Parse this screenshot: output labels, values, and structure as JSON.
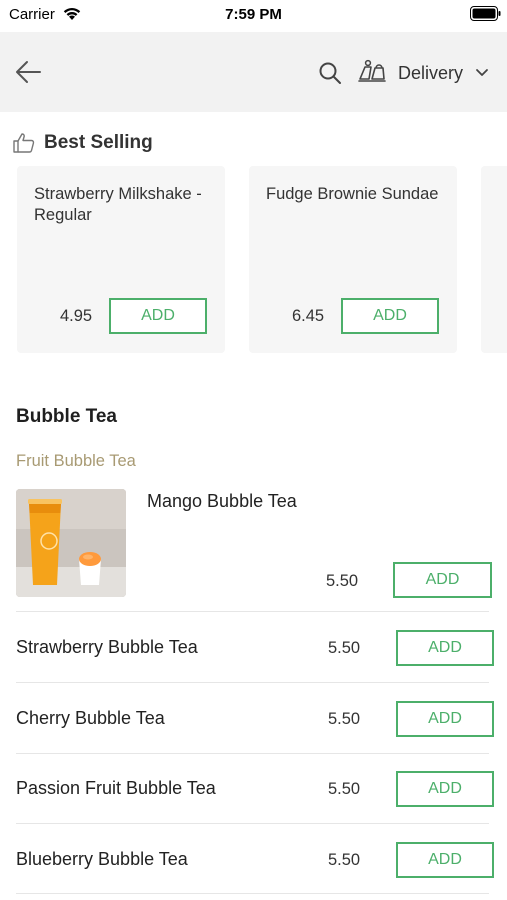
{
  "status_bar": {
    "carrier": "Carrier",
    "time": "7:59 PM"
  },
  "nav": {
    "delivery_label": "Delivery"
  },
  "best_selling": {
    "title": "Best Selling",
    "items": [
      {
        "name": "Strawberry Milkshake - Regular",
        "price": "4.95",
        "add_label": "ADD"
      },
      {
        "name": "Fudge Brownie Sundae",
        "price": "6.45",
        "add_label": "ADD"
      }
    ]
  },
  "category": {
    "title": "Bubble Tea",
    "subcategory": "Fruit Bubble Tea",
    "featured": {
      "name": "Mango Bubble Tea",
      "price": "5.50",
      "add_label": "ADD"
    },
    "items": [
      {
        "name": "Strawberry Bubble Tea",
        "price": "5.50",
        "add_label": "ADD"
      },
      {
        "name": "Cherry Bubble Tea",
        "price": "5.50",
        "add_label": "ADD"
      },
      {
        "name": "Passion Fruit Bubble Tea",
        "price": "5.50",
        "add_label": "ADD"
      },
      {
        "name": "Blueberry Bubble Tea",
        "price": "5.50",
        "add_label": "ADD"
      }
    ]
  },
  "colors": {
    "accent": "#4caf6a",
    "subcategory": "#a89a73",
    "nav_background": "#f2f2f2",
    "card_background": "#f6f6f6"
  },
  "icons": [
    "wifi-icon",
    "battery-icon",
    "back-arrow-icon",
    "search-icon",
    "delivery-icon",
    "chevron-down-icon",
    "thumbs-up-icon"
  ]
}
